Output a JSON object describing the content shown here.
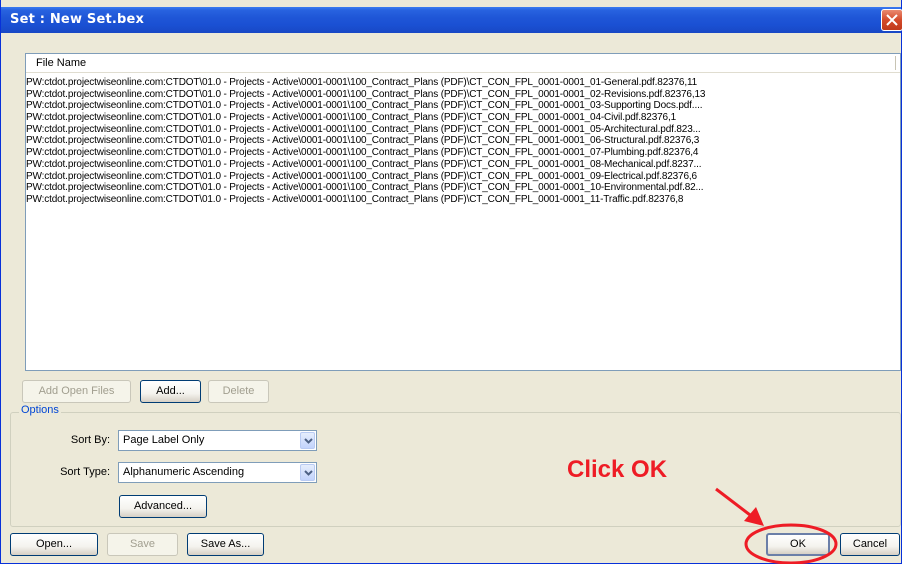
{
  "window": {
    "title": "Set : New Set.bex"
  },
  "file_list": {
    "column_header": "File Name",
    "rows": [
      "PW:ctdot.projectwiseonline.com:CTDOT\\01.0 - Projects - Active\\0001-0001\\100_Contract_Plans (PDF)\\CT_CON_FPL_0001-0001_01-General.pdf.82376,11",
      "PW:ctdot.projectwiseonline.com:CTDOT\\01.0 - Projects - Active\\0001-0001\\100_Contract_Plans (PDF)\\CT_CON_FPL_0001-0001_02-Revisions.pdf.82376,13",
      "PW:ctdot.projectwiseonline.com:CTDOT\\01.0 - Projects - Active\\0001-0001\\100_Contract_Plans (PDF)\\CT_CON_FPL_0001-0001_03-Supporting Docs.pdf....",
      "PW:ctdot.projectwiseonline.com:CTDOT\\01.0 - Projects - Active\\0001-0001\\100_Contract_Plans (PDF)\\CT_CON_FPL_0001-0001_04-Civil.pdf.82376,1",
      "PW:ctdot.projectwiseonline.com:CTDOT\\01.0 - Projects - Active\\0001-0001\\100_Contract_Plans (PDF)\\CT_CON_FPL_0001-0001_05-Architectural.pdf.823...",
      "PW:ctdot.projectwiseonline.com:CTDOT\\01.0 - Projects - Active\\0001-0001\\100_Contract_Plans (PDF)\\CT_CON_FPL_0001-0001_06-Structural.pdf.82376,3",
      "PW:ctdot.projectwiseonline.com:CTDOT\\01.0 - Projects - Active\\0001-0001\\100_Contract_Plans (PDF)\\CT_CON_FPL_0001-0001_07-Plumbing.pdf.82376,4",
      "PW:ctdot.projectwiseonline.com:CTDOT\\01.0 - Projects - Active\\0001-0001\\100_Contract_Plans (PDF)\\CT_CON_FPL_0001-0001_08-Mechanical.pdf.8237...",
      "PW:ctdot.projectwiseonline.com:CTDOT\\01.0 - Projects - Active\\0001-0001\\100_Contract_Plans (PDF)\\CT_CON_FPL_0001-0001_09-Electrical.pdf.82376,6",
      "PW:ctdot.projectwiseonline.com:CTDOT\\01.0 - Projects - Active\\0001-0001\\100_Contract_Plans (PDF)\\CT_CON_FPL_0001-0001_10-Environmental.pdf.82...",
      "PW:ctdot.projectwiseonline.com:CTDOT\\01.0 - Projects - Active\\0001-0001\\100_Contract_Plans (PDF)\\CT_CON_FPL_0001-0001_11-Traffic.pdf.82376,8"
    ]
  },
  "list_buttons": {
    "add_open_files": "Add Open Files",
    "add": "Add...",
    "delete": "Delete"
  },
  "options": {
    "legend": "Options",
    "sort_by_label": "Sort By:",
    "sort_by_value": "Page Label Only",
    "sort_type_label": "Sort Type:",
    "sort_type_value": "Alphanumeric Ascending",
    "advanced": "Advanced..."
  },
  "bottom_buttons": {
    "open": "Open...",
    "save": "Save",
    "save_as": "Save As...",
    "ok": "OK",
    "cancel": "Cancel"
  },
  "annotation": {
    "text": "Click OK",
    "color": "#ee1c25"
  },
  "icons": {
    "close": "close-icon",
    "dropdown": "chevron-down-icon",
    "arrow": "arrow-icon"
  },
  "colors": {
    "titlebar": "#1f56d7",
    "window_bg": "#ece9d8",
    "options_legend": "#0046d5",
    "highlight": "#ee1c25"
  }
}
